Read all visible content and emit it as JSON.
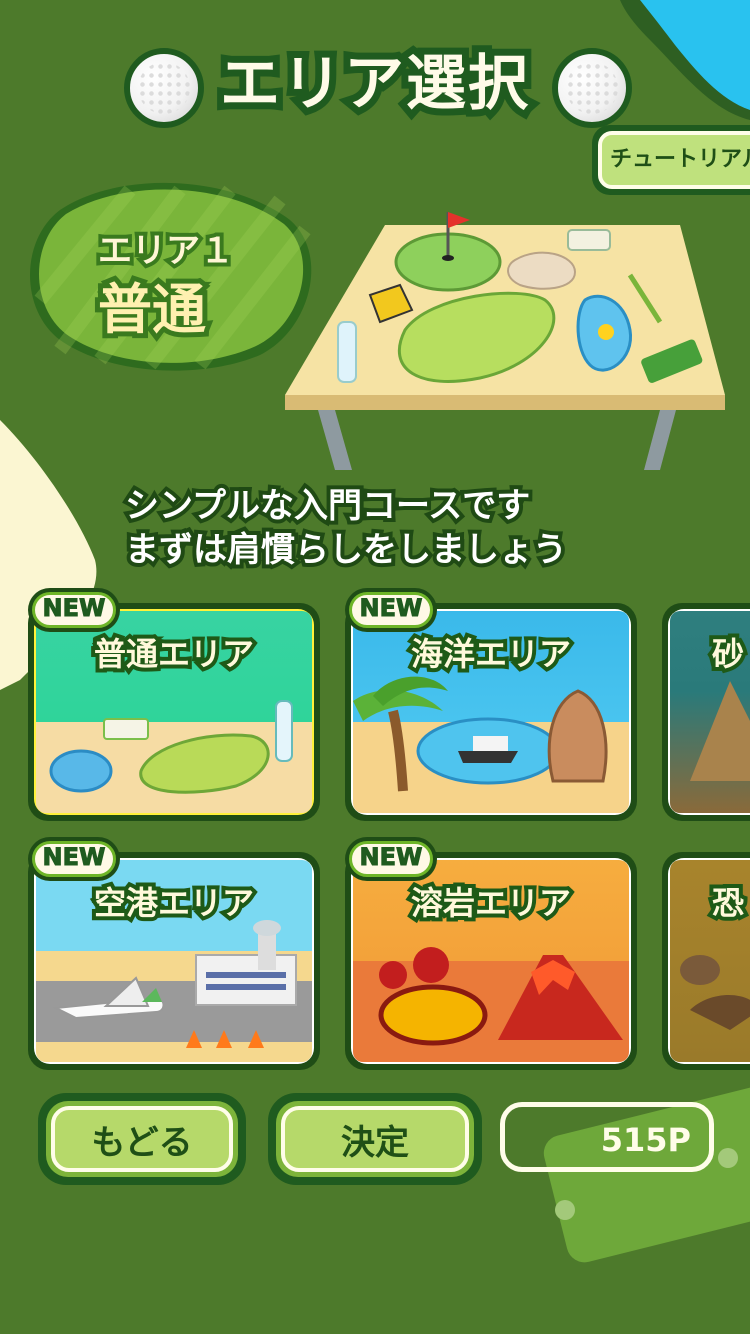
{
  "screen": {
    "title": "エリア選択",
    "tutorial_label": "チュートリアル"
  },
  "current_area": {
    "number_label": "エリア１",
    "name": "普通",
    "description_lines": [
      "シンプルな入門コースです",
      "まずは肩慣らしをしましょう"
    ]
  },
  "areas": [
    {
      "title": "普通エリア",
      "badge": "NEW",
      "selected": true
    },
    {
      "title": "海洋エリア",
      "badge": "NEW",
      "selected": false
    },
    {
      "title": "砂",
      "badge": "",
      "selected": false
    },
    {
      "title": "空港エリア",
      "badge": "NEW",
      "selected": false
    },
    {
      "title": "溶岩エリア",
      "badge": "NEW",
      "selected": false
    },
    {
      "title": "恐",
      "badge": "",
      "selected": false
    }
  ],
  "footer": {
    "back_label": "もどる",
    "confirm_label": "決定",
    "points": "515P"
  },
  "colors": {
    "background": "#4d7a2b",
    "accent_yellow": "#fff23a",
    "dark_green": "#1f5b1f"
  }
}
